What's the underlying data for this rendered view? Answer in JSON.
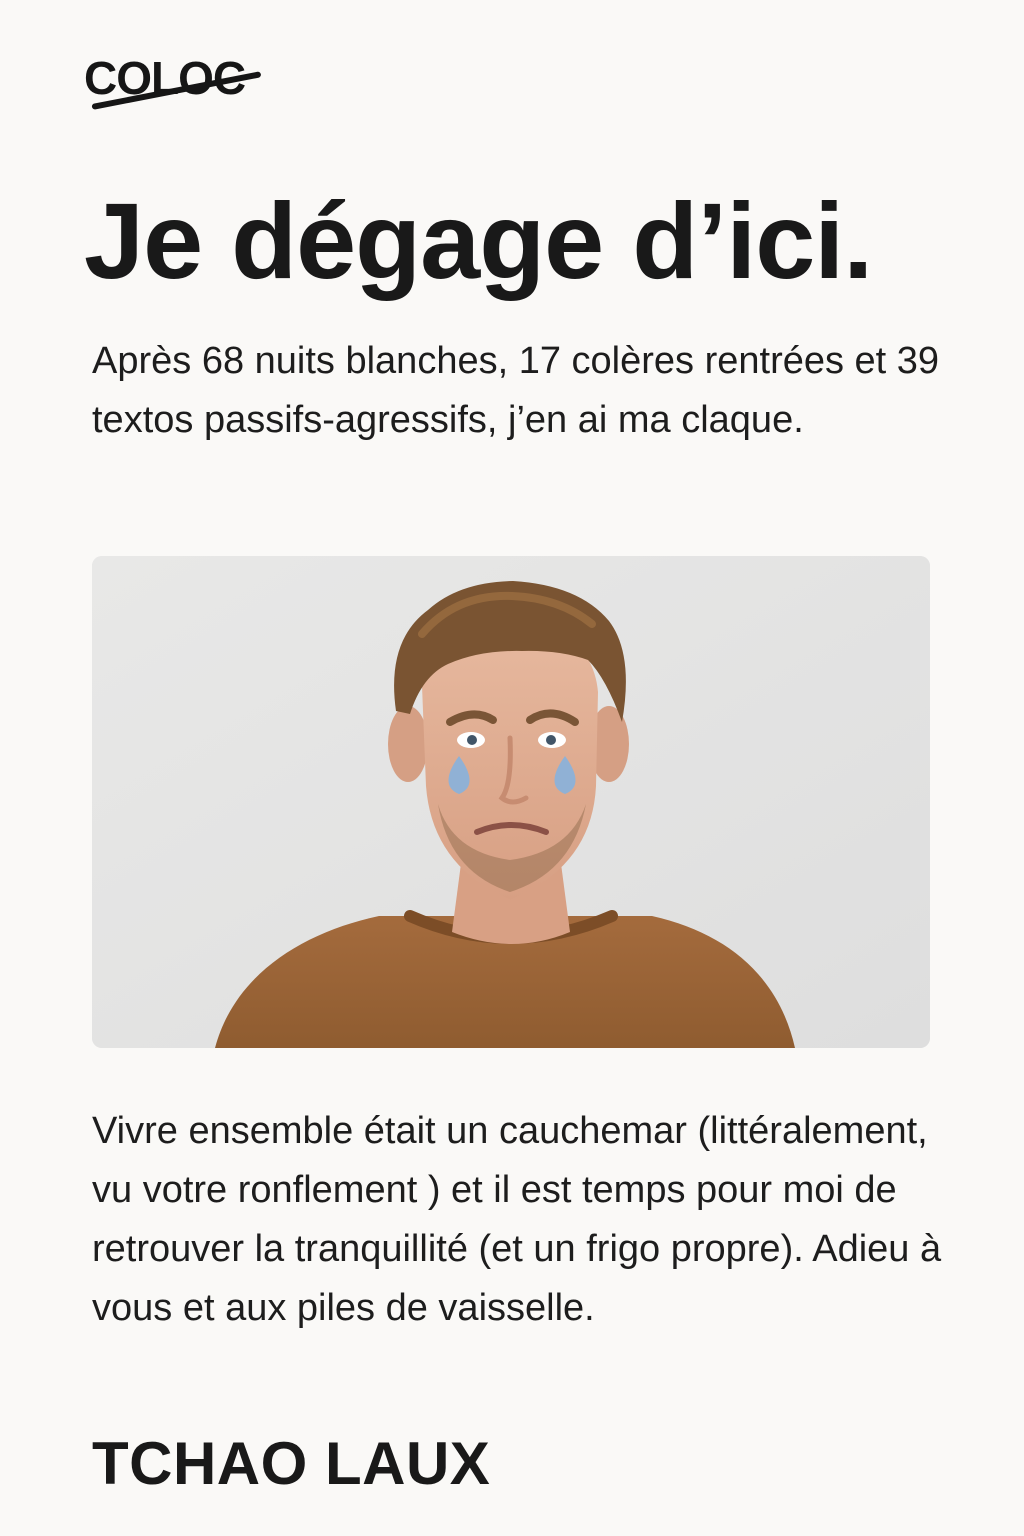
{
  "brand": {
    "logo_text": "COLOC"
  },
  "headline": "Je dégage d’ici.",
  "intro_text": "Après 68 nuits blanches, 17 colères rentrées et 39 textos passifs-agressifs, j’en ai ma claque.",
  "photo": {
    "subject": "homme-triste-en-larmes"
  },
  "body_text": "Vivre ensemble était un cauchemar (littéralement, vu votre ronflement ) et il est temps pour moi de retrouver la tranquillité (et un frigo propre). Adieu à vous et aux piles de vaisselle.",
  "signoff": "TCHAO LAUX",
  "colors": {
    "background": "#faf9f7",
    "text": "#1c1c1c",
    "photo_background": "#e4e4e3",
    "sweater": "#9a6538",
    "tears": "#90b1d5"
  }
}
